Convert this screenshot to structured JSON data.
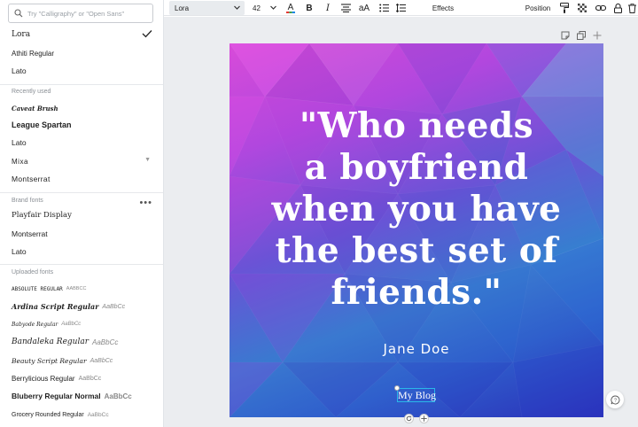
{
  "font_panel": {
    "search_placeholder": "Try \"Calligraphy\" or \"Open Sans\"",
    "top_fonts": [
      {
        "name": "Lora",
        "selected": true
      },
      {
        "name": "Athiti Regular"
      },
      {
        "name": "Lato"
      }
    ],
    "recently_used_label": "Recently used",
    "recently_used": [
      "Caveat Brush",
      "League Spartan",
      "Lato",
      "Mixa",
      "Montserrat"
    ],
    "brand_fonts_label": "Brand fonts",
    "brand_fonts": [
      "Playfair Display",
      "Montserrat",
      "Lato"
    ],
    "uploaded_fonts_label": "Uploaded fonts",
    "uploaded_fonts": [
      {
        "name": "ABSOLUTE REGULAR",
        "sample": "AABBCC"
      },
      {
        "name": "Ardina Script Regular",
        "sample": "AaBbCc"
      },
      {
        "name": "Babyode Regular",
        "sample": "AaBbCc"
      },
      {
        "name": "Bandaleka Regular",
        "sample": "AaBbCc"
      },
      {
        "name": "Beauty Script Regular",
        "sample": "AaBbCc"
      },
      {
        "name": "Berrylicious Regular",
        "sample": "AaBbCc"
      },
      {
        "name": "Bluberry Regular Normal",
        "sample": "AaBbCc"
      },
      {
        "name": "Grocery Rounded Regular",
        "sample": "AaBbCc"
      }
    ]
  },
  "toolbar": {
    "font_name": "Lora",
    "font_size": "42",
    "text_color": "#ffffff",
    "effects_label": "Effects",
    "position_label": "Position",
    "bold_glyph": "B",
    "italic_glyph": "I",
    "case_glyph": "aA"
  },
  "design": {
    "quote": "\"Who needs a boyfriend when you have the best set of friends.\"",
    "quote_lines": [
      "\"Who needs",
      "a boyfriend",
      "when you have",
      "the best set of",
      "friends.\""
    ],
    "author": "Jane Doe",
    "blog": "My Blog"
  },
  "colors": {
    "accent_selection": "#2ab7e9",
    "panel_border": "#e1e4e8",
    "workspace_bg": "#ebedf0"
  }
}
